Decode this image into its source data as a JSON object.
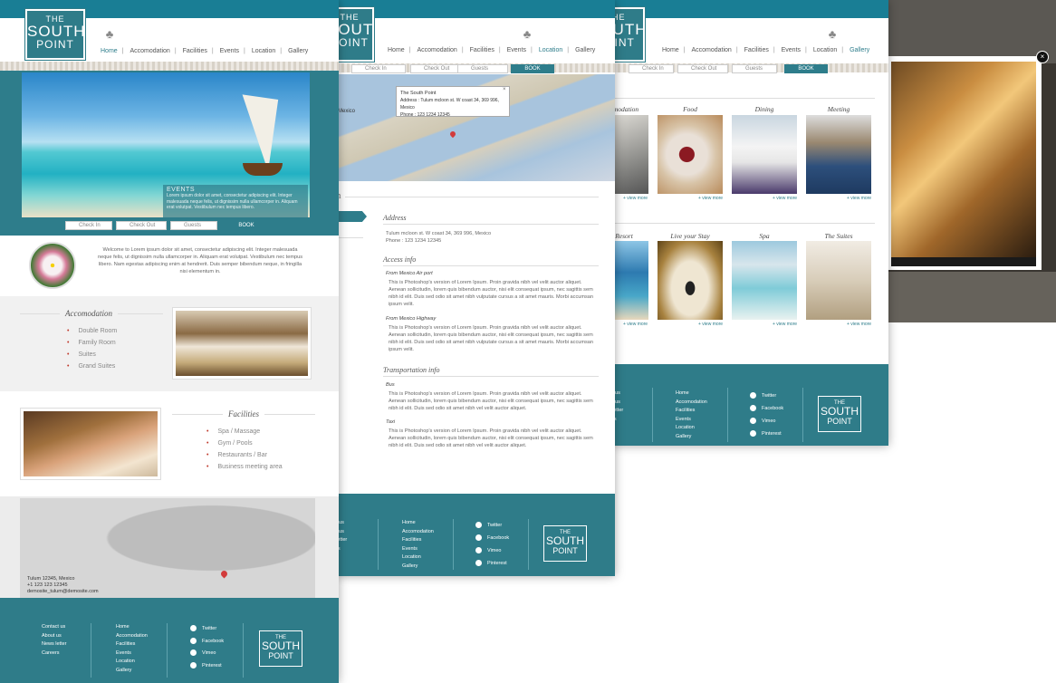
{
  "brand": {
    "line1": "THE",
    "line2": "SOUTH",
    "line3": "POINT"
  },
  "nav": [
    "Home",
    "Accomodation",
    "Facilities",
    "Events",
    "Location",
    "Gallery"
  ],
  "booking": {
    "check_in": "Check In",
    "check_out": "Check Out",
    "guests": "Guests",
    "book": "BOOK"
  },
  "page1": {
    "hero_caption_title": "EVENTS",
    "hero_caption_text": "Lorem ipsum dolor sit amet, consectetur adipiscing elit. Integer malesuada neque felis, ut dignissim nulla ullamcorper in. Aliquam erat volutpat. Vestibulum nec tempus libero.",
    "welcome": "Welcome to Lorem ipsum dolor sit amet, consectetur adipiscing elit. Integer malesuada neque felis, ut dignissim nulla ullamcorper in. Aliquam erat volutpat. Vestibulum nec tempus libero. Nam egestas adipiscing enim at hendrerit. Duis semper bibendum neque, in fringilla nisi elementum in.",
    "accomodation_title": "Accomodation",
    "accomodation_items": [
      "Double Room",
      "Family Room",
      "Suites",
      "Grand Suites"
    ],
    "facilities_title": "Facilities",
    "facilities_items": [
      "Spa / Massage",
      "Gym / Pools",
      "Restaurants / Bar",
      "Business meeting area"
    ],
    "map_address": "Tulum 12345, Mexico",
    "map_phone": "+1 123 123 12345",
    "map_email": "demosite_tulum@demosite.com"
  },
  "footer": {
    "col1": [
      "Contact us",
      "About us",
      "News letter",
      "Careers"
    ],
    "col2": [
      "Home",
      "Accomodation",
      "Facilities",
      "Events",
      "Location",
      "Gallery"
    ],
    "social": [
      "Twitter",
      "Facebook",
      "Vimeo",
      "Pinterest"
    ],
    "col1_partial": [
      "t us",
      "t us",
      "letter",
      "rs"
    ],
    "col1_partial3": [
      "ct us",
      "us",
      "s letter",
      "ers"
    ]
  },
  "page2": {
    "map_popup_title": "The South Point",
    "map_popup_address": "Address : Tulum mcloon st. W coast 34, 369 996, Mexico",
    "map_popup_phone": "Phone : 123 1234 12345",
    "map_label": "Mexico",
    "section_fragment": "n",
    "left_tab_fragment": "s",
    "address_title": "Address",
    "address_line1": "Tulum mcloon st. W coast 34, 369 996, Mexico",
    "address_line2": "Phone : 123 1234 12345",
    "access_title": "Access info",
    "access_sub1": "From Mexico Air port",
    "access_text1": "This is Photoshop's version of Lorem Ipsum. Proin gravida nibh vel velit auctor aliquet. Aenean sollicitudin, lorem quis bibendum auctor, nisi elit consequat ipsum, nec sagittis sem nibh id elit. Duis sed odio sit amet nibh vulputate cursus a sit amet mauris. Morbi accumsan ipsum velit.",
    "access_sub2": "From Mexico Highway",
    "access_text2": "This is Photoshop's version of Lorem Ipsum. Proin gravida nibh vel velit auctor aliquet. Aenean sollicitudin, lorem quis bibendum auctor, nisi elit consequat ipsum, nec sagittis sem nibh id elit. Duis sed odio sit amet nibh vulputate cursus a sit amet mauris. Morbi accumsan ipsum velit.",
    "transport_title": "Transportation info",
    "transport_sub1": "Bus",
    "transport_text1": "This is Photoshop's version of Lorem Ipsum. Proin gravida nibh vel velit auctor aliquet. Aenean sollicitudin, lorem quis bibendum auctor, nisi elit consequat ipsum, nec sagittis sem nibh id elit. Duis sed odio sit amet nibh vel velit auctor aliquet.",
    "transport_sub2": "Taxi",
    "transport_text2": "This is Photoshop's version of Lorem Ipsum. Proin gravida nibh vel velit auctor aliquet. Aenean sollicitudin, lorem quis bibendum auctor, nisi elit consequat ipsum, nec sagittis sem nibh id elit. Duis sed odio sit amet nibh vel velit auctor aliquet."
  },
  "page3": {
    "row1": [
      "modation",
      "Food",
      "Dining",
      "Meeting"
    ],
    "row2": [
      "Resort",
      "Live your Stay",
      "Spa",
      "The Suites"
    ],
    "view_more": "+ view more"
  }
}
